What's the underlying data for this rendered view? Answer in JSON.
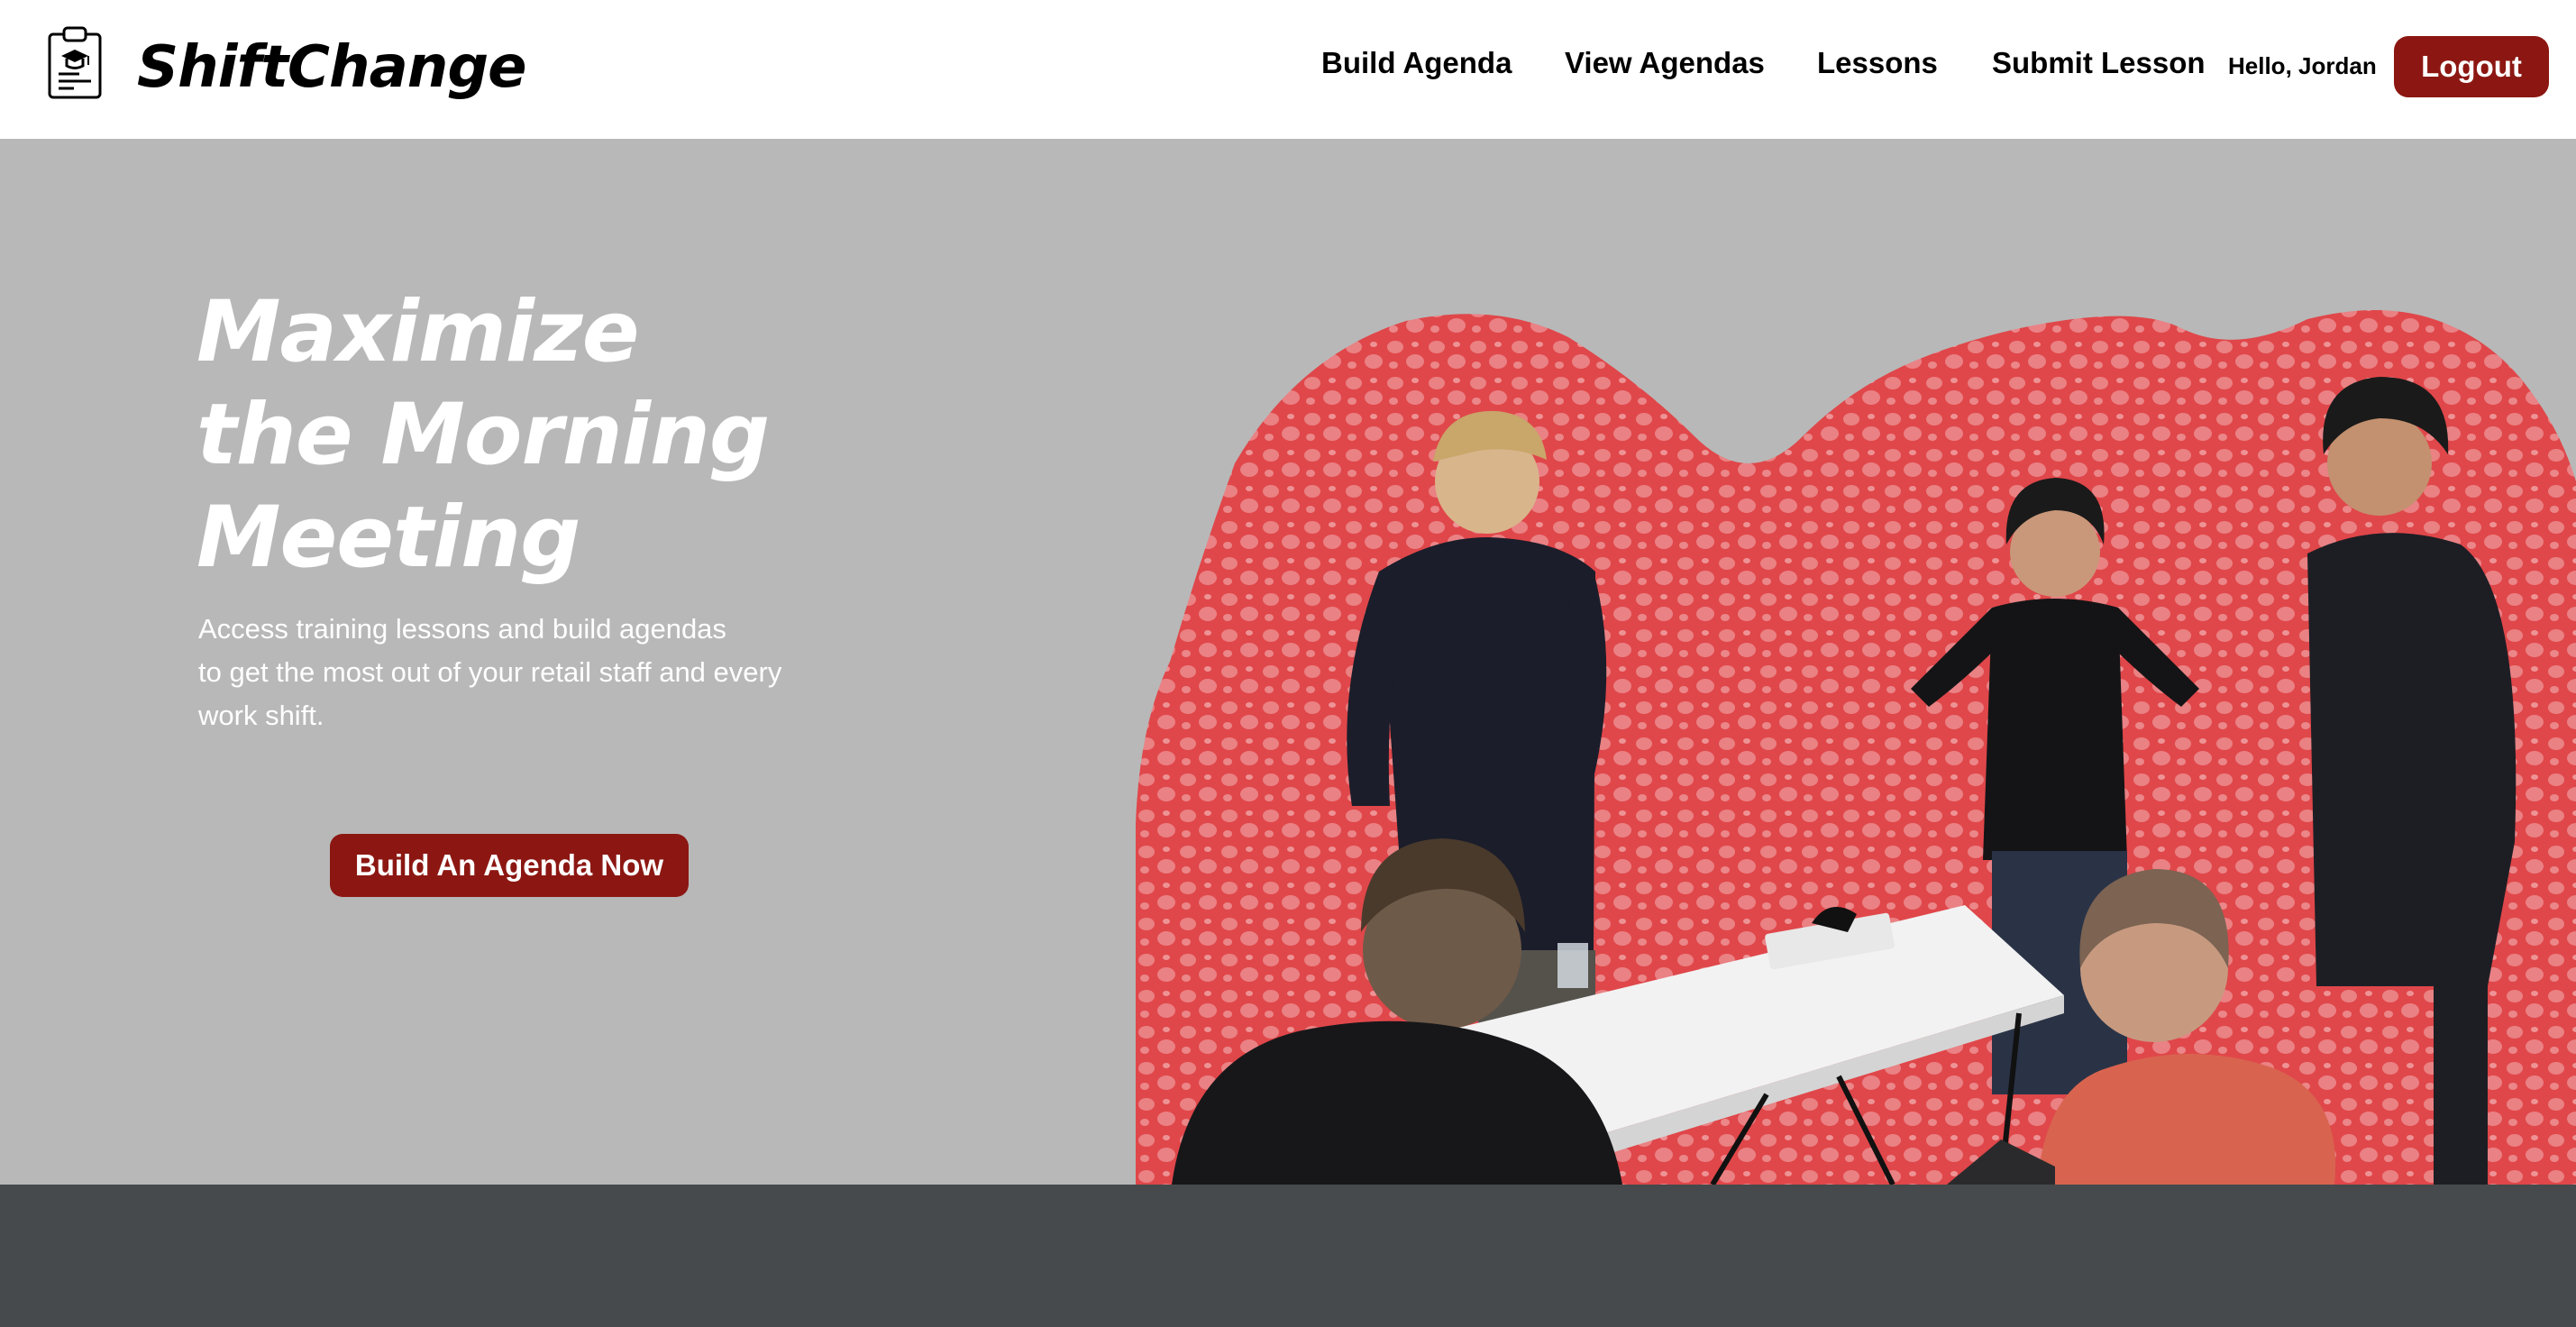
{
  "brand": {
    "name": "ShiftChange",
    "logo_icon": "clipboard-graduation-cap-icon"
  },
  "nav": {
    "items": [
      {
        "label": "Build Agenda"
      },
      {
        "label": "View Agendas"
      },
      {
        "label": "Lessons"
      },
      {
        "label": "Submit Lesson"
      }
    ],
    "greeting": "Hello, Jordan",
    "logout_label": "Logout"
  },
  "hero": {
    "title_lines": [
      "Maximize",
      "the Morning",
      "Meeting"
    ],
    "description_lines": [
      "Access training lessons and build agendas",
      "to get the most out of your retail staff and every",
      "work shift."
    ],
    "cta_label": "Build An Agenda Now",
    "image_subject": "team-meeting-photo"
  },
  "colors": {
    "accent": "#8c1712",
    "hero_background": "#b8b8b8",
    "art_splash": "#e0474a",
    "footer_band": "#474a4c",
    "header_background": "#ffffff"
  }
}
